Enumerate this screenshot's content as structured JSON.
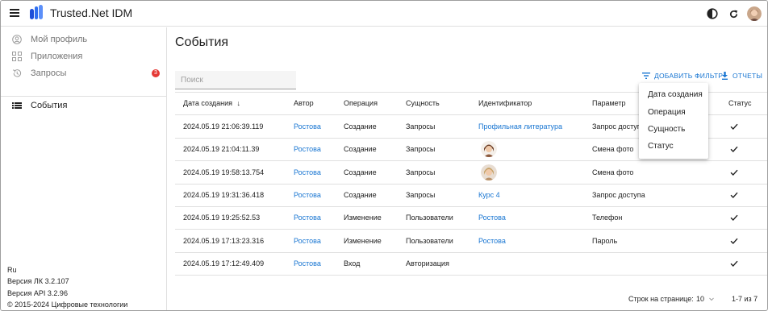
{
  "app": {
    "title": "Trusted.Net IDM"
  },
  "sidebar": {
    "items": [
      {
        "label": "Мой профиль",
        "icon": "account-circle-icon"
      },
      {
        "label": "Приложения",
        "icon": "apps-grid-icon"
      },
      {
        "label": "Запросы",
        "icon": "history-icon",
        "badge": "3"
      },
      {
        "label": "События",
        "icon": "list-icon"
      }
    ],
    "footer": {
      "lang": "Ru",
      "lk_version": "Версия ЛК 3.2.107",
      "api_version": "Версия API 3.2.96",
      "copyright": "© 2015-2024 Цифровые технологии"
    }
  },
  "main": {
    "title": "События",
    "search": {
      "placeholder": "Поиск",
      "value": ""
    },
    "add_filter_label": "ДОБАВИТЬ ФИЛЬТР",
    "reports_label": "ОТЧЕТЫ",
    "columns": [
      "Дата создания",
      "Автор",
      "Операция",
      "Сущность",
      "Идентификатор",
      "Параметр",
      "Статус"
    ],
    "sort_indicator": "↓",
    "rows": [
      {
        "date": "2024.05.19 21:06:39.119",
        "author": "Ростова",
        "operation": "Создание",
        "entity": "Запросы",
        "identifier": "Профильная литература",
        "identifier_type": "link",
        "param": "Запрос доступа",
        "status": "✓"
      },
      {
        "date": "2024.05.19 21:04:11.39",
        "author": "Ростова",
        "operation": "Создание",
        "entity": "Запросы",
        "identifier": "",
        "identifier_type": "photo",
        "param": "Смена фото",
        "status": "✓"
      },
      {
        "date": "2024.05.19 19:58:13.754",
        "author": "Ростова",
        "operation": "Создание",
        "entity": "Запросы",
        "identifier": "",
        "identifier_type": "photo",
        "param": "Смена фото",
        "status": "✓"
      },
      {
        "date": "2024.05.19 19:31:36.418",
        "author": "Ростова",
        "operation": "Создание",
        "entity": "Запросы",
        "identifier": "Курс 4",
        "identifier_type": "link",
        "param": "Запрос доступа",
        "status": "✓"
      },
      {
        "date": "2024.05.19 19:25:52.53",
        "author": "Ростова",
        "operation": "Изменение",
        "entity": "Пользователи",
        "identifier": "Ростова",
        "identifier_type": "link",
        "param": "Телефон",
        "status": "✓"
      },
      {
        "date": "2024.05.19 17:13:23.316",
        "author": "Ростова",
        "operation": "Изменение",
        "entity": "Пользователи",
        "identifier": "Ростова",
        "identifier_type": "link",
        "param": "Пароль",
        "status": "✓"
      },
      {
        "date": "2024.05.19 17:12:49.409",
        "author": "Ростова",
        "operation": "Вход",
        "entity": "Авторизация",
        "identifier": "",
        "identifier_type": "none",
        "param": "",
        "status": "✓"
      }
    ],
    "filter_menu": [
      "Дата создания",
      "Операция",
      "Сущность",
      "Статус"
    ],
    "pagination": {
      "rows_per_page_label": "Строк на странице:",
      "rows_per_page": "10",
      "range": "1-7 из 7"
    }
  },
  "colors": {
    "accent": "#1976d2",
    "badge": "#e53935",
    "logo": "#1e4fd8"
  }
}
